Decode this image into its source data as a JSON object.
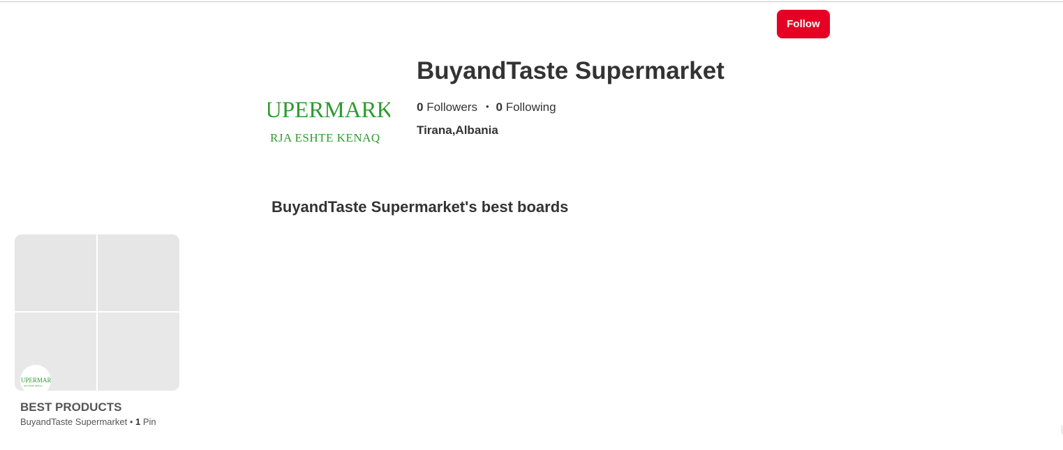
{
  "header": {
    "follow_label": "Follow"
  },
  "profile": {
    "name": "BuyandTaste Supermarket",
    "followers_count": "0",
    "followers_label": "Followers",
    "following_count": "0",
    "following_label": "Following",
    "separator": "•",
    "location": "Tirana,Albania",
    "avatar_logo_text": "UPERMARK",
    "avatar_logo_subtext": "RJA ESHTE KENAQ"
  },
  "boards_section": {
    "title": "BuyandTaste Supermarket's best boards",
    "boards": [
      {
        "title": "BEST PRODUCTS",
        "owner": "BuyandTaste Supermarket",
        "separator": "•",
        "pin_count": "1",
        "pin_label": "Pin"
      }
    ]
  },
  "colors": {
    "follow_button": "#e60023",
    "logo_green": "#2e9a2e",
    "placeholder_tile": "#e6e6e6"
  }
}
